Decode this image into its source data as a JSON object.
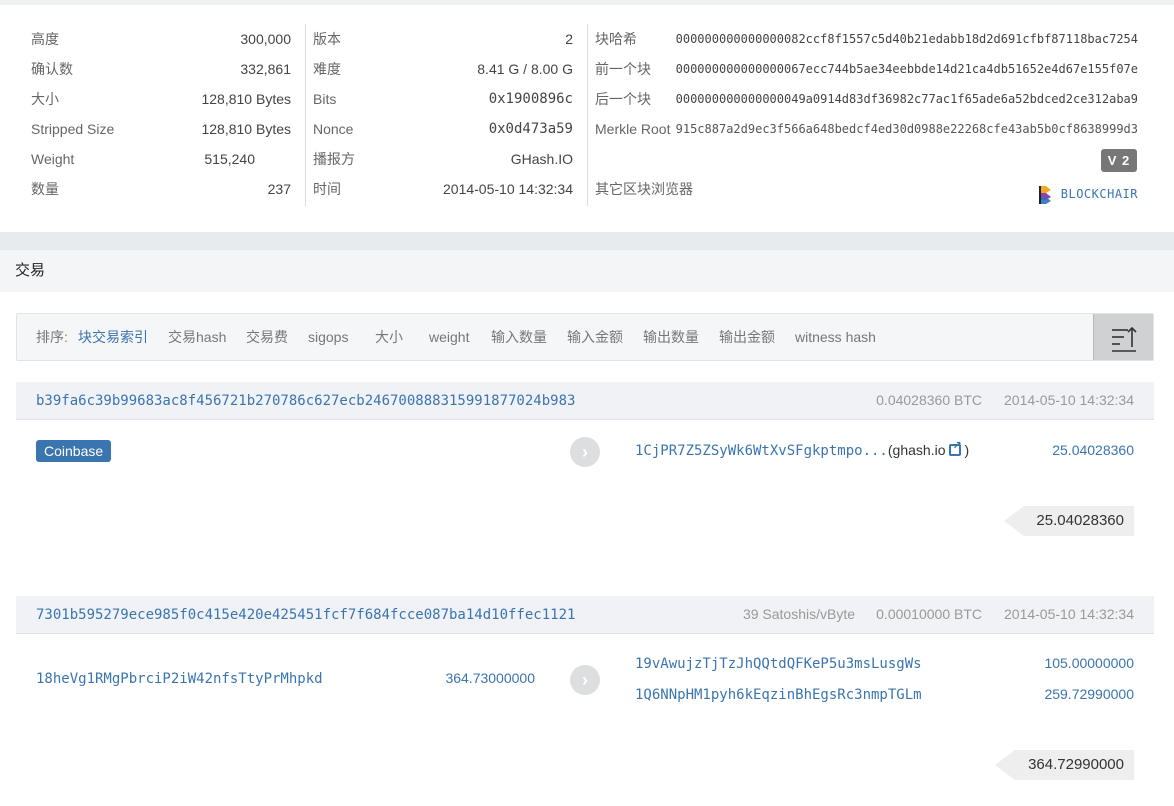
{
  "block_info": {
    "col1": [
      {
        "label": "高度",
        "value": "300,000"
      },
      {
        "label": "确认数",
        "value": "332,861"
      },
      {
        "label": "大小",
        "value": "128,810 Bytes"
      },
      {
        "label": "Stripped Size",
        "value": "128,810 Bytes"
      },
      {
        "label": "Weight",
        "value": "515,240"
      },
      {
        "label": "数量",
        "value": "237"
      }
    ],
    "col2": [
      {
        "label": "版本",
        "value": "2"
      },
      {
        "label": "难度",
        "value": "8.41 G / 8.00 G"
      },
      {
        "label": "Bits",
        "value": "0x1900896c"
      },
      {
        "label": "Nonce",
        "value": "0x0d473a59"
      },
      {
        "label": "播报方",
        "value": "GHash.IO"
      },
      {
        "label": "时间",
        "value": "2014-05-10 14:32:34"
      }
    ],
    "col3": [
      {
        "label": "块哈希",
        "value": "000000000000000082ccf8f1557c5d40b21edabb18d2d691cfbf87118bac7254"
      },
      {
        "label": "前一个块",
        "value": "000000000000000067ecc744b5ae34eebbde14d21ca4db51652e4d67e155f07e"
      },
      {
        "label": "后一个块",
        "value": "000000000000000049a0914d83df36982c77ac1f65ade6a52bdced2ce312aba9"
      },
      {
        "label": "Merkle Root",
        "value": "915c887a2d9ec3f566a648bedcf4ed30d0988e22268cfe43ab5b0cf8638999d3"
      },
      {
        "label": "其它区块浏览器",
        "value": ""
      }
    ],
    "version_badge": "V 2",
    "explorer_name": "BLOCKCHAIR"
  },
  "section": {
    "title": "交易"
  },
  "sortbar": {
    "prefix": "排序:",
    "options": [
      "块交易索引",
      "交易hash",
      "交易费",
      "sigops",
      "大小",
      "weight",
      "输入数量",
      "输入金额",
      "输出数量",
      "输出金额",
      "witness hash"
    ]
  },
  "transactions": [
    {
      "hash": "b39fa6c39b99683ac8f456721b270786c627ecb24670088831599187702 4b983",
      "hash_display": "b39fa6c39b99683ac8f456721b270786c627ecb246700888315991877024b983",
      "fee": "0.04028360 BTC",
      "time": "2014-05-10 14:32:34",
      "input_label": "Coinbase",
      "outputs": [
        {
          "address": "1CjPR7Z5ZSyWk6WtXvSFgkptmpo...",
          "tag": "ghash.io",
          "amount": "25.04028360"
        }
      ],
      "total": "25.04028360"
    },
    {
      "hash_display": "7301b595279ece985f0c415e420e425451fcf7f684fcce087ba14d10ffec1121",
      "feerate": "39 Satoshis/vByte",
      "fee": "0.00010000 BTC",
      "time": "2014-05-10 14:32:34",
      "inputs": [
        {
          "address": "18heVg1RMgPbrciP2iW42nfsTtyPrMhpkd",
          "amount": "364.73000000"
        }
      ],
      "outputs": [
        {
          "address": "19vAwujzTjTzJhQQtdQFKeP5u3msLusgWs",
          "amount": "105.00000000"
        },
        {
          "address": "1Q6NNpHM1pyh6kEqzinBhEgsRc3nmpTGLm",
          "amount": "259.72990000"
        }
      ],
      "total": "364.72990000"
    }
  ],
  "colors": {
    "link": "#3a75b0",
    "badge": "#777777",
    "coinbase": "#3a75b0"
  }
}
